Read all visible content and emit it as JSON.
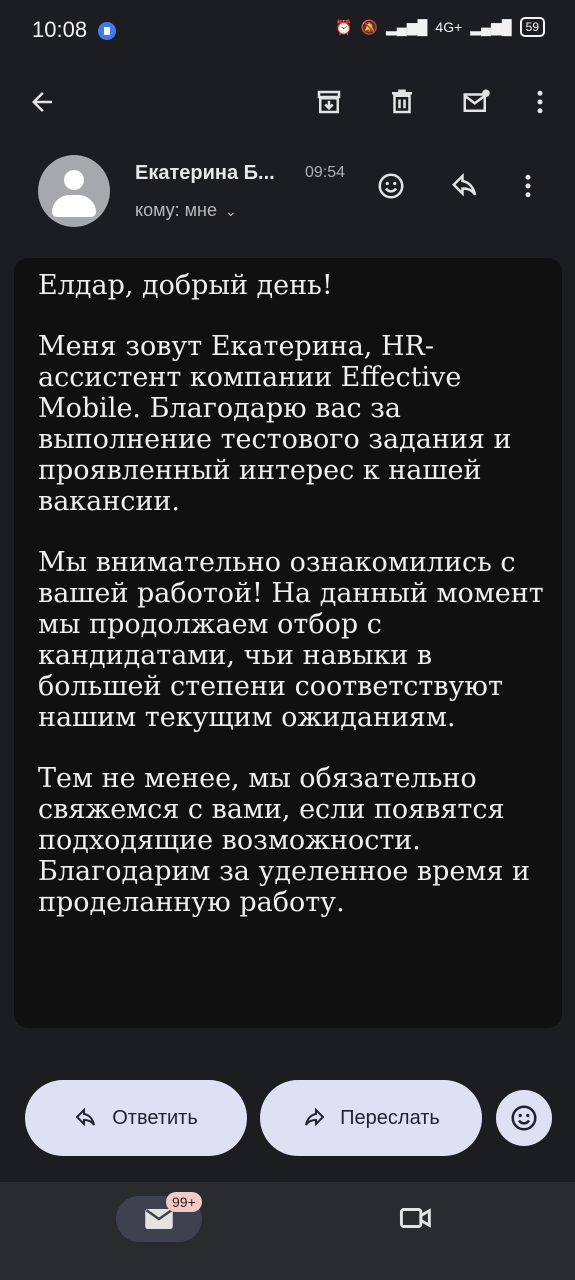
{
  "status_bar": {
    "time": "10:08",
    "battery": "59",
    "network": "4G+"
  },
  "toolbar": {
    "back": "arrow-back-icon",
    "archive": "archive-icon",
    "delete": "trash-icon",
    "unread": "mark-unread-icon",
    "more": "more-vert-icon"
  },
  "message": {
    "sender": "Екатерина Б...",
    "time": "09:54",
    "recipient": "кому: мне",
    "paragraphs": [
      "Елдар, добрый день!",
      "Меня зовут Екатерина, HR-ассистент компании Effective Mobile. Благодарю вас за выполнение тестового задания и проявленный интерес к нашей вакансии.",
      "Мы внимательно ознакомились с вашей работой! На данный момент мы продолжаем отбор с кандидатами, чьи навыки в большей степени соответствуют нашим текущим ожиданиям.",
      "Тем не менее, мы обязательно свяжемся с вами, если появятся подходящие возможности. Благодарим за уделенное время и проделанную работу."
    ]
  },
  "actions": {
    "reply": "Ответить",
    "forward": "Переслать"
  },
  "bottom_nav": {
    "mail_badge": "99+"
  },
  "colors": {
    "background": "#1c1d21",
    "pill": "#dde1f3",
    "badge": "#f1c9c6"
  }
}
